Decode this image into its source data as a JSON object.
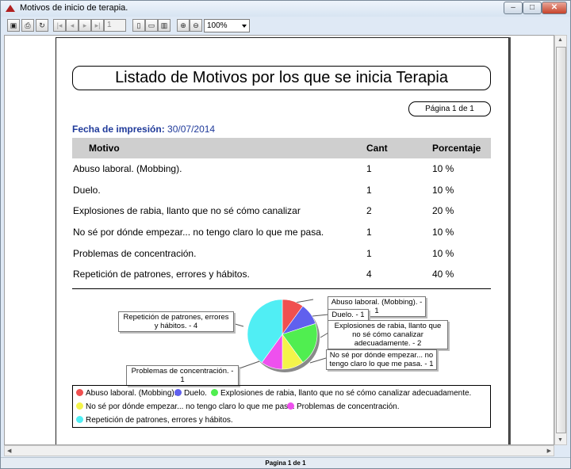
{
  "window": {
    "title": "Motivos de inicio de terapia."
  },
  "toolbar": {
    "page_value": "1",
    "zoom_value": "100%"
  },
  "report": {
    "title": "Listado de Motivos por los que se inicia Terapia",
    "page_label": "Página 1 de 1",
    "fecha_label": "Fecha de impresión:",
    "fecha_value": "30/07/2014"
  },
  "table": {
    "headers": [
      "Motivo",
      "Cant",
      "Porcentaje"
    ],
    "rows": [
      {
        "motivo": "Abuso laboral. (Mobbing).",
        "cant": "1",
        "pct": "10 %"
      },
      {
        "motivo": "Duelo.",
        "cant": "1",
        "pct": "10 %"
      },
      {
        "motivo": "Explosiones de rabia, llanto que no sé cómo canalizar",
        "cant": "2",
        "pct": "20 %"
      },
      {
        "motivo": "No sé por dónde empezar... no tengo claro lo que me pasa.",
        "cant": "1",
        "pct": "10 %"
      },
      {
        "motivo": "Problemas de concentración.",
        "cant": "1",
        "pct": "10 %"
      },
      {
        "motivo": "Repetición de patrones, errores y hábitos.",
        "cant": "4",
        "pct": "40 %"
      }
    ]
  },
  "callouts": {
    "abuso": "Abuso laboral. (Mobbing). - 1",
    "duelo": "Duelo. - 1",
    "explosiones": "Explosiones de rabia, llanto que no sé cómo canalizar adecuadamente. - 2",
    "nose": "No sé por dónde empezar... no tengo claro lo que me pasa. - 1",
    "problemas": "Problemas de concentración. - 1",
    "repeticion": "Repetición de patrones, errores y hábitos. - 4"
  },
  "chart_data": {
    "type": "pie",
    "categories": [
      "Abuso laboral. (Mobbing).",
      "Duelo.",
      "Explosiones de rabia, llanto que no sé cómo canalizar adecuadamente.",
      "No sé por dónde empezar... no tengo claro lo que me pasa.",
      "Problemas de concentración.",
      "Repetición de patrones, errores y hábitos."
    ],
    "values": [
      1,
      1,
      2,
      1,
      1,
      4
    ],
    "colors": [
      "#f05050",
      "#6060ee",
      "#50ee50",
      "#f4f44a",
      "#ee50ee",
      "#50eef4"
    ],
    "legend_position": "bottom"
  },
  "status": {
    "text": "Pagina 1 de 1"
  }
}
